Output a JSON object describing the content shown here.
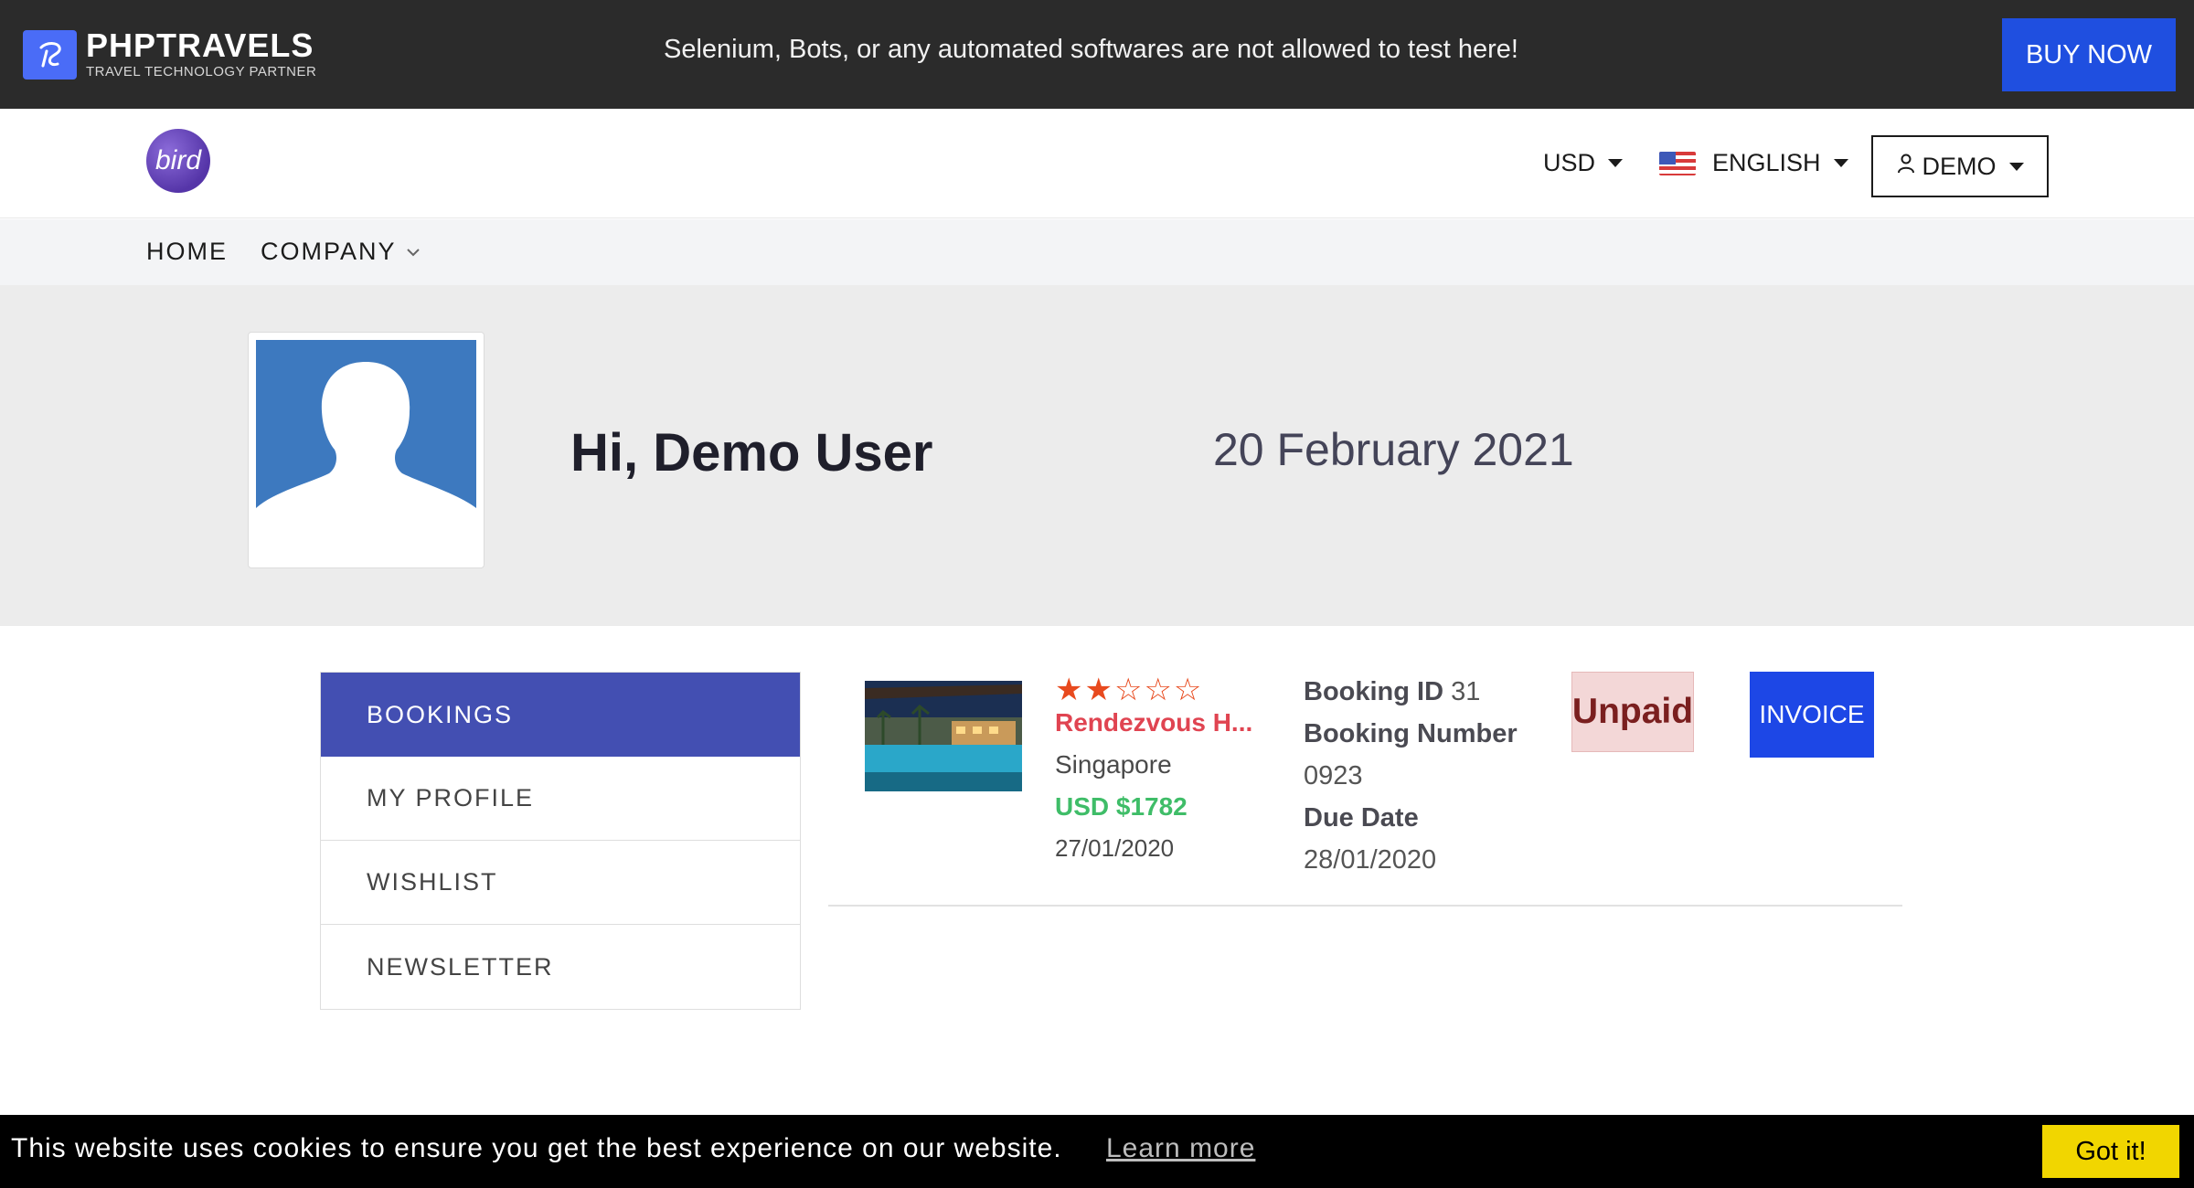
{
  "topbar": {
    "brand_name": "PHPTRAVELS",
    "brand_tagline": "TRAVEL TECHNOLOGY PARTNER",
    "notice": "Selenium, Bots, or any automated softwares are not allowed to test here!",
    "buy_now_label": "BUY NOW"
  },
  "header": {
    "logo_text": "bird",
    "currency": "USD",
    "language": "ENGLISH",
    "account_label": "DEMO"
  },
  "nav": {
    "items": [
      {
        "label": "HOME"
      },
      {
        "label": "COMPANY"
      }
    ]
  },
  "profile": {
    "greeting": "Hi, Demo User",
    "date": "20 February 2021"
  },
  "sidebar": {
    "items": [
      {
        "label": "BOOKINGS",
        "active": true
      },
      {
        "label": "MY PROFILE"
      },
      {
        "label": "WISHLIST"
      },
      {
        "label": "NEWSLETTER"
      }
    ]
  },
  "booking": {
    "stars": "★★☆☆☆",
    "rating": 2,
    "rating_max": 5,
    "hotel_name": "Rendezvous H...",
    "city": "Singapore",
    "price": "USD $1782",
    "booked_date": "27/01/2020",
    "booking_id_label": "Booking ID",
    "booking_id": "31",
    "booking_number_label": "Booking Number",
    "booking_number": "0923",
    "due_date_label": "Due Date",
    "due_date": "28/01/2020",
    "status": "Unpaid",
    "invoice_label": "INVOICE"
  },
  "cookie": {
    "message": "This website uses cookies to ensure you get the best experience on our website.",
    "learn_more": "Learn more",
    "accept_label": "Got it!"
  },
  "colors": {
    "topbar_bg": "#2b2b2b",
    "buy_now": "#1f4fe0",
    "sidebar_active": "#434fb2",
    "hotel_name": "#e04451",
    "price": "#3fbd68",
    "unpaid_bg": "#f3d7d7",
    "invoice": "#1d47e6",
    "cookie_accept": "#f1d600"
  }
}
